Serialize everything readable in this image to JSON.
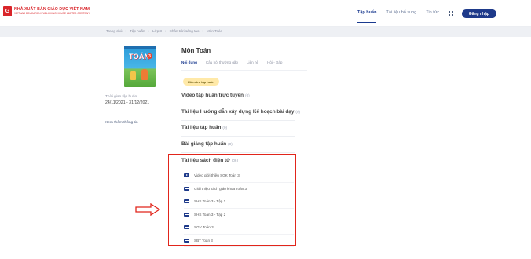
{
  "logo": {
    "mark": "G",
    "name": "NHÀ XUẤT BẢN GIÁO DỤC VIỆT NAM",
    "sub": "VIETNAM EDUCATION PUBLISHING HOUSE LIMITED COMPANY"
  },
  "nav": {
    "items": [
      "Tập huấn",
      "Tài liệu bổ sung",
      "Tin tức"
    ],
    "active": "Tập huấn",
    "login": "Đăng nhập",
    "apps_icon": "grid-icon"
  },
  "breadcrumb": [
    "Trang chủ",
    "Tập huấn",
    "Lớp 3",
    "Chân trời sáng tạo",
    "Môn Toán"
  ],
  "book": {
    "title": "TOÁN",
    "grade": "3"
  },
  "sidebar": {
    "period_label": "Thời gian tập huấn",
    "period_value": "24/11/2021 - 31/12/2021",
    "more_info": "Xem thêm thông tin"
  },
  "main": {
    "title": "Môn Toán",
    "tabs": [
      "Nội dung",
      "Câu hỏi thường gặp",
      "Liên hệ",
      "Hỏi - Đáp"
    ],
    "active_tab": "Nội dung",
    "test_button": "Kiểm tra tập huấn",
    "sections": [
      {
        "title": "Video tập huấn trực tuyến",
        "count": "(0)"
      },
      {
        "title": "Tài liệu Hướng dẫn xây dựng Kế hoạch bài dạy",
        "count": "(0)"
      },
      {
        "title": "Tài liệu tập huấn",
        "count": "(0)"
      },
      {
        "title": "Bài giảng tập huấn",
        "count": "(0)"
      },
      {
        "title": "Tài liệu sách điện tử",
        "count": "(06)"
      }
    ],
    "files": [
      {
        "name": "Video giới thiệu SGK Toán 3",
        "icon": "play"
      },
      {
        "name": "Giới thiệu sách giáo khoa Toán 3",
        "icon": "doc"
      },
      {
        "name": "SHS Toán 3 - Tập 1",
        "icon": "doc"
      },
      {
        "name": "SHS Toán 3 - Tập 2",
        "icon": "doc"
      },
      {
        "name": "SGV Toán 3",
        "icon": "doc"
      },
      {
        "name": "SBT Toán 3",
        "icon": "doc"
      }
    ]
  },
  "colors": {
    "accent": "#1e3a8a",
    "highlight": "#e1251b",
    "brand": "#d9252a"
  }
}
